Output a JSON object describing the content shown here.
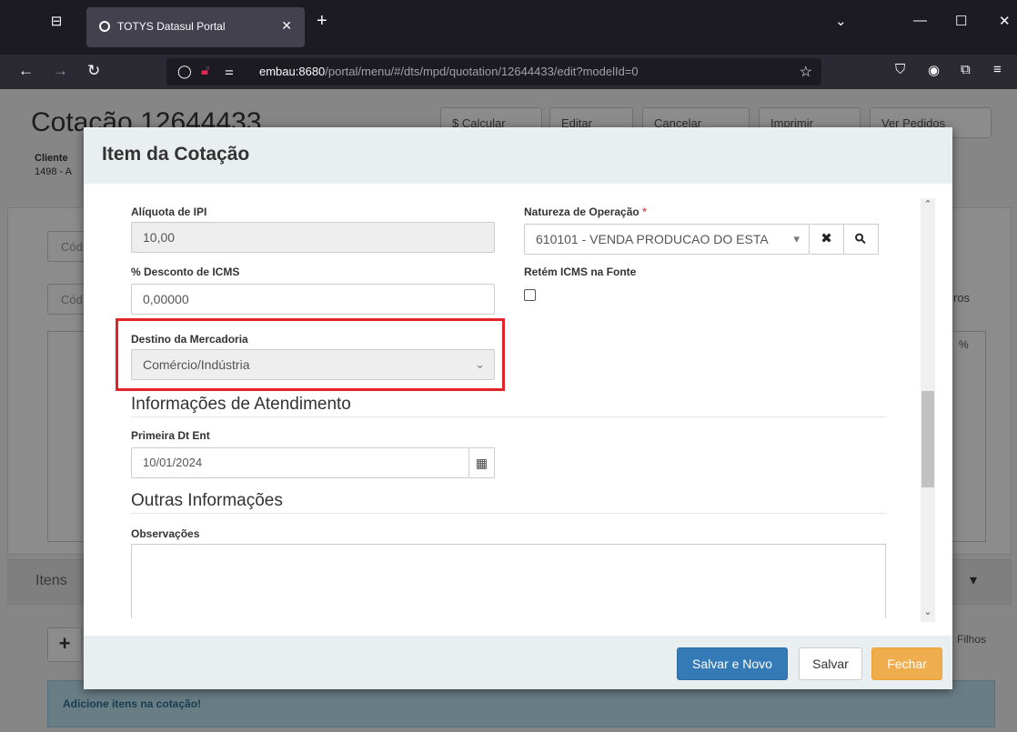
{
  "browser": {
    "tab_title": "TOTYS Datasul Portal",
    "url_host": "embau:8680",
    "url_path": "/portal/menu/#/dts/mpd/quotation/12644433/edit?modelId=0"
  },
  "page": {
    "title": "Cotação 12644433",
    "buttons": [
      "$ Calcular",
      "Editar",
      "Cancelar",
      "Imprimir",
      "Ver Pedidos"
    ],
    "client_label": "Cliente",
    "client_value": "1498 - A",
    "bg_input_1": "Cód",
    "bg_input_2": "Cód",
    "itens_label": "Itens",
    "alert_text": "Adicione itens na cotação!",
    "right_label_1": "ros",
    "right_label_2": "%",
    "right_label_3": "Filhos"
  },
  "modal": {
    "title": "Item da Cotação",
    "aliquota_ipi": {
      "label": "Alíquota de IPI",
      "value": "10,00"
    },
    "natureza": {
      "label": "Natureza de Operação",
      "required_mark": "*",
      "value": "610101 - VENDA PRODUCAO DO ESTA"
    },
    "desconto_icms": {
      "label": "% Desconto de ICMS",
      "value": "0,00000"
    },
    "retem_icms": {
      "label": "Retém ICMS na Fonte"
    },
    "destino": {
      "label": "Destino da Mercadoria",
      "value": "Comércio/Indústria"
    },
    "section_atendimento": "Informações de Atendimento",
    "primeira_dt": {
      "label": "Primeira Dt Ent",
      "value": "10/01/2024"
    },
    "section_outras": "Outras Informações",
    "observacoes": {
      "label": "Observações"
    },
    "footer": {
      "save_new": "Salvar e Novo",
      "save": "Salvar",
      "close": "Fechar"
    }
  },
  "icons": {
    "clear": "✖",
    "search": "⚲",
    "calendar": "▦",
    "dropdown": "▾",
    "chevron": "⌄"
  }
}
